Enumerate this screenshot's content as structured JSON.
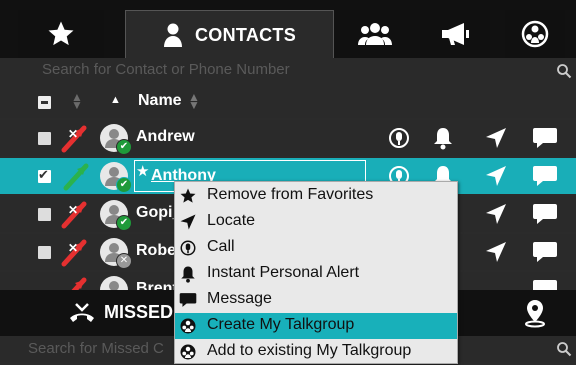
{
  "tabs": {
    "contacts_label": "CONTACTS"
  },
  "search": {
    "placeholder": "Search for Contact or Phone Number"
  },
  "header": {
    "name_label": "Name"
  },
  "contacts": [
    {
      "name": "Andrew",
      "status": "online"
    },
    {
      "name": "Anthony",
      "status": "online",
      "favorite": true,
      "selected": true
    },
    {
      "name": "Gopi_",
      "status": "online"
    },
    {
      "name": "Robe",
      "status": "offline"
    },
    {
      "name": "Brent",
      "status": "online"
    }
  ],
  "bottom": {
    "missed_label": "MISSED",
    "search_placeholder": "Search for Missed C"
  },
  "context_menu": {
    "items": [
      {
        "label": "Remove from Favorites",
        "icon": "star-icon"
      },
      {
        "label": "Locate",
        "icon": "locate-arrow-icon"
      },
      {
        "label": "Call",
        "icon": "call-icon"
      },
      {
        "label": "Instant Personal Alert",
        "icon": "alert-bell-icon"
      },
      {
        "label": "Message",
        "icon": "message-bubble-icon"
      },
      {
        "label": "Create My Talkgroup",
        "icon": "talkgroup-icon",
        "highlighted": true
      },
      {
        "label": "Add to existing My Talkgroup",
        "icon": "talkgroup-icon"
      }
    ]
  },
  "colors": {
    "accent": "#19aeb8",
    "background": "#2a2a2a",
    "tabbar": "#111111",
    "online": "#1f9a3a",
    "offline": "#999999"
  }
}
